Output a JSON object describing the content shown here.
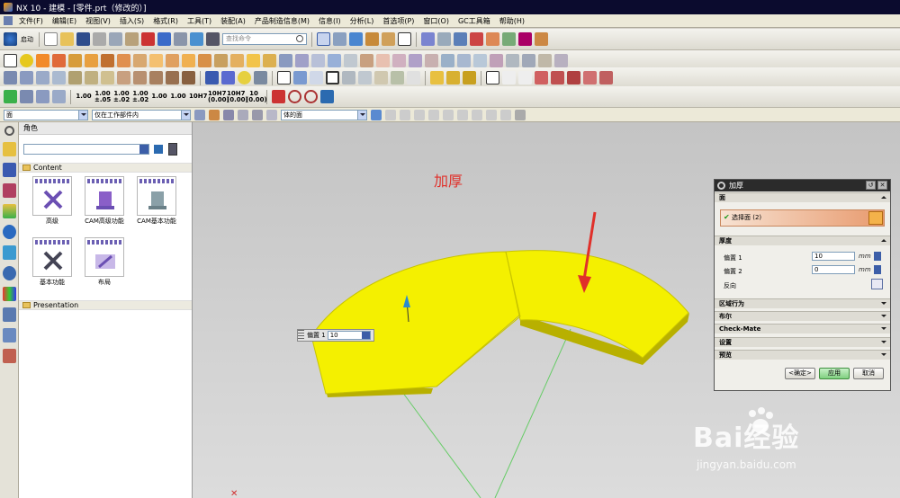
{
  "window": {
    "title": "NX 10 - 建模 - [零件.prt（修改的）]"
  },
  "menu": [
    "文件(F)",
    "编辑(E)",
    "视图(V)",
    "插入(S)",
    "格式(R)",
    "工具(T)",
    "装配(A)",
    "产品制造信息(M)",
    "信息(I)",
    "分析(L)",
    "首选项(P)",
    "窗口(O)",
    "GC工具箱",
    "帮助(H)"
  ],
  "toolbar": {
    "start_label": "启动",
    "search_placeholder": "查找命令",
    "numbers": [
      "1.00",
      "1.00\n±.05",
      "1.00\n±.02",
      "1.00\n±.02",
      "1.00",
      "1.00",
      "10H7",
      "10H7\n(0.00)",
      "10H7\n(0.00)",
      "10\n(0.00)"
    ]
  },
  "filterbar": {
    "type_filter": "面",
    "scope_filter": "仅在工作部件内",
    "face_rule": "体的面"
  },
  "navigator": {
    "title": "角色",
    "groups": [
      {
        "name": "Content"
      },
      {
        "name": "Presentation"
      }
    ],
    "roles": [
      {
        "label": "高级"
      },
      {
        "label": "CAM高级功能"
      },
      {
        "label": "CAM基本功能"
      },
      {
        "label": "基本功能"
      },
      {
        "label": "布局"
      }
    ]
  },
  "viewport": {
    "annotation": "加厚",
    "offset_label": "偏置 1",
    "offset_value": "10"
  },
  "dialog": {
    "title": "加厚",
    "section_face": "面",
    "select_face": "选择面 (2)",
    "section_thickness": "厚度",
    "offset1_label": "偏置 1",
    "offset1_value": "10",
    "offset2_label": "偏置 2",
    "offset2_value": "0",
    "unit": "mm",
    "reverse_label": "反向",
    "section_region": "区域行为",
    "section_boolean": "布尔",
    "section_checkmate": "Check-Mate",
    "section_settings": "设置",
    "section_preview": "预览",
    "ok": "<确定>",
    "apply": "应用",
    "cancel": "取消"
  },
  "watermark": {
    "logo": "Bai经验",
    "url": "jingyan.baidu.com"
  },
  "colors": {
    "solid": "#f4f000",
    "arrow": "#e0302a",
    "titlebar": "#0b0b2e"
  }
}
